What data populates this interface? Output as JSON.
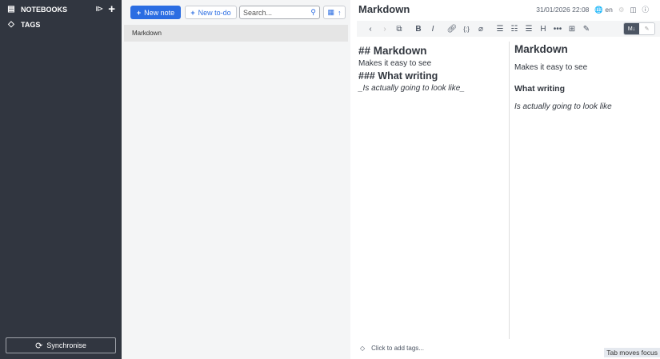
{
  "sidebar": {
    "notebooks": "NOTEBOOKS",
    "tags": "TAGS",
    "sync": "Synchronise"
  },
  "notelist": {
    "new_note": "New note",
    "new_todo": "New to-do",
    "search_placeholder": "Search...",
    "notes": [
      "Markdown"
    ]
  },
  "editor": {
    "title": "Markdown",
    "date": "31/01/2026 22:08",
    "lang": "en",
    "source": {
      "h2": "## Markdown",
      "p": "Makes it easy to see",
      "h3": "### What writing",
      "em": "_Is actually going to look like_"
    },
    "preview": {
      "h2": "Markdown",
      "p": "Makes it easy to see",
      "h3": "What writing",
      "em": "Is actually going to look like"
    },
    "md_toggle": "M↓",
    "tags_placeholder": "Click to add tags...",
    "tab_focus": "Tab moves focus"
  },
  "colors": {
    "sidebar": "#313640",
    "accent": "#2b6de2"
  }
}
